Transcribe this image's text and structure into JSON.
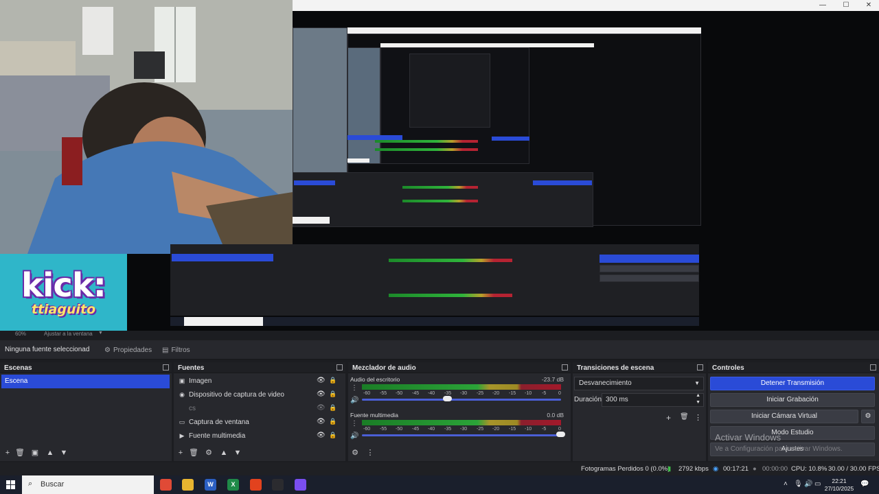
{
  "titlebar": {
    "minimize": "—",
    "maximize": "☐",
    "close": "✕"
  },
  "overlay": {
    "kick_line1": "kick:",
    "kick_line2": "ttiaguito"
  },
  "zoom": {
    "percent": "60%",
    "fit_label": "Ajustar a la ventana"
  },
  "properties_bar": {
    "no_selection": "Ninguna fuente seleccionad",
    "properties_label": "Propiedades",
    "filters_label": "Filtros"
  },
  "scenes": {
    "title": "Escenas",
    "items": [
      {
        "label": "Escena",
        "selected": true
      }
    ]
  },
  "sources": {
    "title": "Fuentes",
    "items": [
      {
        "label": "Imagen",
        "icon": "image-icon",
        "glyph": "▣"
      },
      {
        "label": "Dispositivo de captura de video",
        "icon": "camera-icon",
        "glyph": "◉"
      },
      {
        "label": "cs",
        "icon": "folder-icon",
        "glyph": ""
      },
      {
        "label": "Captura de ventana",
        "icon": "window-icon",
        "glyph": "▭"
      },
      {
        "label": "Fuente multimedia",
        "icon": "play-icon",
        "glyph": "▶"
      }
    ]
  },
  "mixer": {
    "title": "Mezclador de audio",
    "ticks": [
      "-60",
      "-55",
      "-50",
      "-45",
      "-40",
      "-35",
      "-30",
      "-25",
      "-20",
      "-15",
      "-10",
      "-5",
      "0"
    ],
    "channels": [
      {
        "name": "Audio del escritorio",
        "db": "-23.7 dB",
        "volume_fraction": 0.43
      },
      {
        "name": "Fuente multimedia",
        "db": "0.0 dB",
        "volume_fraction": 1.0
      }
    ]
  },
  "transitions": {
    "title": "Transiciones de escena",
    "selected": "Desvanecimiento",
    "duration_label": "Duración",
    "duration_value": "300 ms"
  },
  "controls": {
    "title": "Controles",
    "stop_stream": "Detener Transmisión",
    "start_recording": "Iniciar Grabación",
    "start_virtual_cam": "Iniciar Cámara Virtual",
    "studio_mode": "Modo Estudio",
    "settings": "Ajustes",
    "activate_title": "Activar Windows",
    "activate_sub": "Ve a Configuración para activar Windows."
  },
  "status": {
    "dropped_frames": "Fotogramas Perdidos 0 (0.0%)",
    "bitrate": "2792 kbps",
    "stream_time": "00:17:21",
    "rec_time": "00:00:00",
    "cpu": "CPU: 10.8%",
    "fps": "30.00 / 30.00 FPS"
  },
  "taskbar": {
    "search_placeholder": "Buscar",
    "time": "22:21",
    "date": "27/10/2025",
    "apps": [
      {
        "name": "chrome-icon",
        "label": "",
        "color": "#e04a36"
      },
      {
        "name": "file-explorer-icon",
        "label": "",
        "color": "#e8b530"
      },
      {
        "name": "word-icon",
        "label": "W",
        "color": "#2b5fc2"
      },
      {
        "name": "excel-icon",
        "label": "X",
        "color": "#1f8a48"
      },
      {
        "name": "brave-icon",
        "label": "",
        "color": "#e2421e"
      },
      {
        "name": "obs-icon",
        "label": "",
        "color": "#2b2b2f"
      },
      {
        "name": "messenger-icon",
        "label": "",
        "color": "#7a4ef0"
      }
    ]
  }
}
